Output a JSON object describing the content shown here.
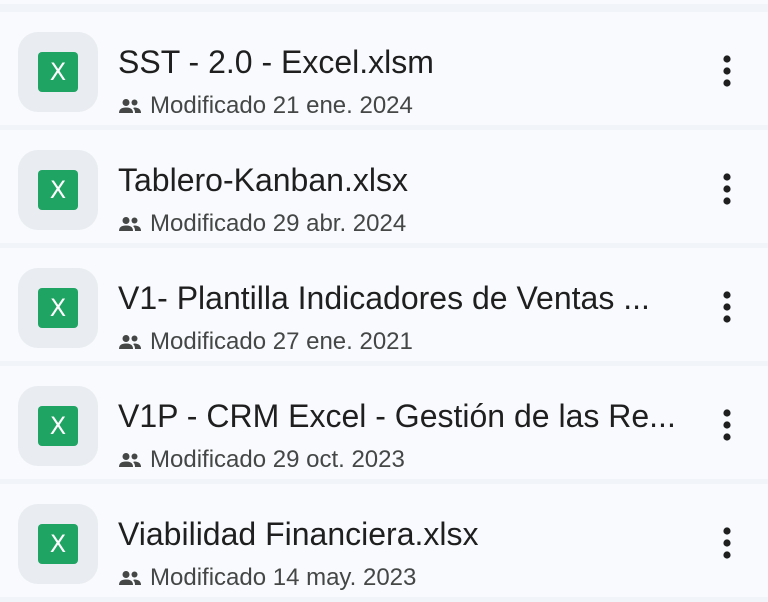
{
  "colors": {
    "excel_green": "#1fa463",
    "row_background": "#f8fafd",
    "separator": "#f1f5f9",
    "title_text": "#1f1f1f",
    "meta_text": "#444746"
  },
  "icons": {
    "file": "excel-icon",
    "file_letter": "X",
    "shared": "people-icon",
    "menu": "more-vert-icon"
  },
  "files": [
    {
      "name": "SST - 2.0 - Excel.xlsm",
      "modified": "Modificado 21 ene. 2024"
    },
    {
      "name": "Tablero-Kanban.xlsx",
      "modified": "Modificado 29 abr. 2024"
    },
    {
      "name": "V1- Plantilla Indicadores de Ventas ...",
      "modified": "Modificado 27 ene. 2021"
    },
    {
      "name": "V1P - CRM Excel - Gestión de las Re...",
      "modified": "Modificado 29 oct. 2023"
    },
    {
      "name": "Viabilidad Financiera.xlsx",
      "modified": "Modificado 14 may. 2023"
    }
  ]
}
